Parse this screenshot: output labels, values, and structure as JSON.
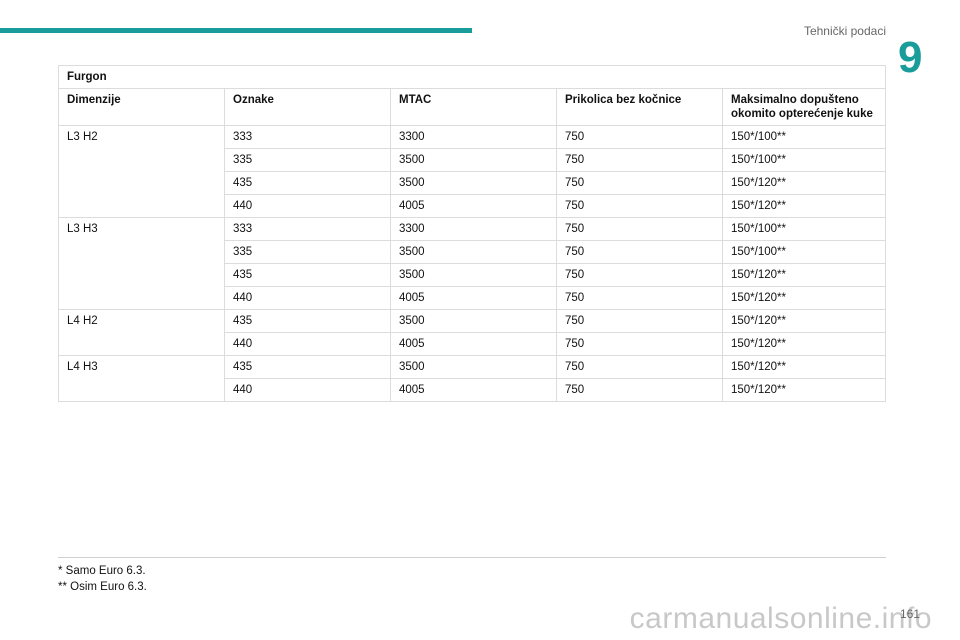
{
  "header": {
    "section_title": "Tehnički podaci",
    "chapter_number": "9"
  },
  "table": {
    "title": "Furgon",
    "columns": [
      "Dimenzije",
      "Oznake",
      "MTAC",
      "Prikolica bez kočnice",
      "Maksimalno dopušteno okomito opterećenje kuke"
    ],
    "groups": [
      {
        "dimension": "L3 H2",
        "rows": [
          [
            "333",
            "3300",
            "750",
            "150*/100**"
          ],
          [
            "335",
            "3500",
            "750",
            "150*/100**"
          ],
          [
            "435",
            "3500",
            "750",
            "150*/120**"
          ],
          [
            "440",
            "4005",
            "750",
            "150*/120**"
          ]
        ]
      },
      {
        "dimension": "L3 H3",
        "rows": [
          [
            "333",
            "3300",
            "750",
            "150*/100**"
          ],
          [
            "335",
            "3500",
            "750",
            "150*/100**"
          ],
          [
            "435",
            "3500",
            "750",
            "150*/120**"
          ],
          [
            "440",
            "4005",
            "750",
            "150*/120**"
          ]
        ]
      },
      {
        "dimension": "L4 H2",
        "rows": [
          [
            "435",
            "3500",
            "750",
            "150*/120**"
          ],
          [
            "440",
            "4005",
            "750",
            "150*/120**"
          ]
        ]
      },
      {
        "dimension": "L4 H3",
        "rows": [
          [
            "435",
            "3500",
            "750",
            "150*/120**"
          ],
          [
            "440",
            "4005",
            "750",
            "150*/120**"
          ]
        ]
      }
    ]
  },
  "footnotes": [
    "*  Samo Euro 6.3.",
    "**  Osim Euro 6.3."
  ],
  "page_number": "161",
  "watermark": "carmanualsonline.info",
  "colors": {
    "accent": "#1a9c9a",
    "border": "#dcdcdc"
  }
}
